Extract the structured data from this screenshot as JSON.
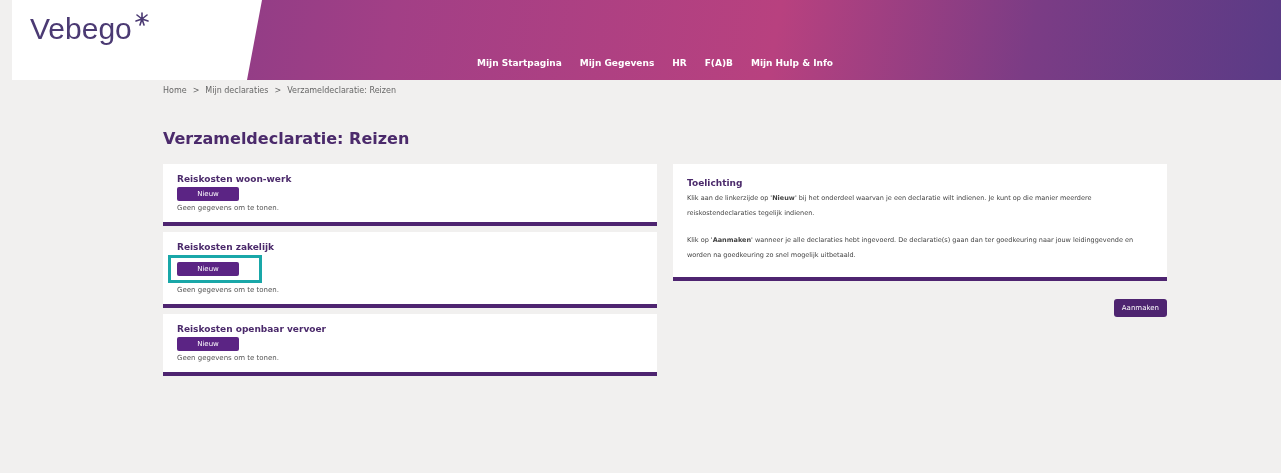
{
  "header": {
    "logo": "Vebego",
    "nav": [
      "Mijn Startpagina",
      "Mijn Gegevens",
      "HR",
      "F(A)B",
      "Mijn Hulp & Info"
    ]
  },
  "breadcrumb": {
    "separator": ">",
    "items": [
      "Home",
      "Mijn declaraties",
      "Verzameldeclaratie: Reizen"
    ]
  },
  "title": "Verzameldeclaratie: Reizen",
  "sections": [
    {
      "title": "Reiskosten woon-werk",
      "button": "Nieuw",
      "empty": "Geen gegevens om te tonen.",
      "highlighted": false
    },
    {
      "title": "Reiskosten zakelijk",
      "button": "Nieuw",
      "empty": "Geen gegevens om te tonen.",
      "highlighted": true
    },
    {
      "title": "Reiskosten openbaar vervoer",
      "button": "Nieuw",
      "empty": "Geen gegevens om te tonen.",
      "highlighted": false
    }
  ],
  "info": {
    "title": "Toelichting",
    "paragraphs": [
      "Klik aan de linkerzijde op '**Nieuw**' bij het onderdeel waarvan je een declaratie wilt indienen. Je kunt op die manier meerdere reiskostendeclaraties tegelijk indienen.",
      "Klik op '**Aanmaken**' wanneer je alle declaraties hebt ingevoerd. De declaratie(s) gaan dan ter goedkeuring naar jouw leidinggevende en worden na goedkeuring zo snel mogelijk uitbetaald."
    ]
  },
  "submit": "Aanmaken"
}
